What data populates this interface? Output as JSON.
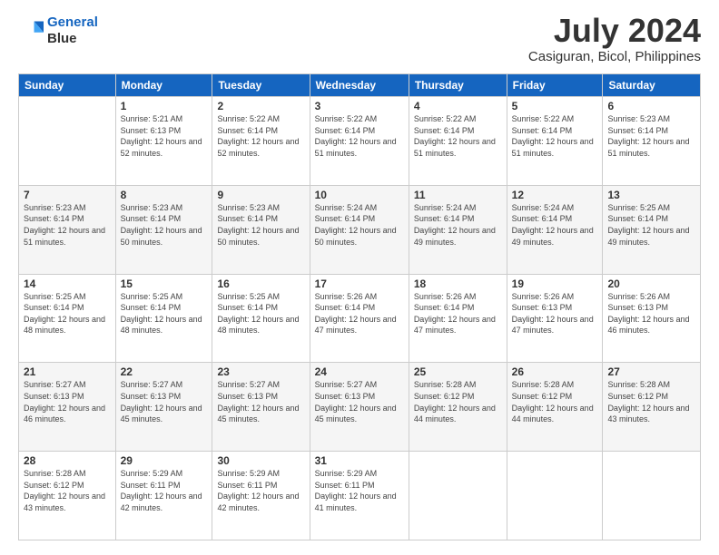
{
  "header": {
    "logo_line1": "General",
    "logo_line2": "Blue",
    "month_title": "July 2024",
    "location": "Casiguran, Bicol, Philippines"
  },
  "weekdays": [
    "Sunday",
    "Monday",
    "Tuesday",
    "Wednesday",
    "Thursday",
    "Friday",
    "Saturday"
  ],
  "weeks": [
    [
      {
        "day": "",
        "sunrise": "",
        "sunset": "",
        "daylight": ""
      },
      {
        "day": "1",
        "sunrise": "Sunrise: 5:21 AM",
        "sunset": "Sunset: 6:13 PM",
        "daylight": "Daylight: 12 hours and 52 minutes."
      },
      {
        "day": "2",
        "sunrise": "Sunrise: 5:22 AM",
        "sunset": "Sunset: 6:14 PM",
        "daylight": "Daylight: 12 hours and 52 minutes."
      },
      {
        "day": "3",
        "sunrise": "Sunrise: 5:22 AM",
        "sunset": "Sunset: 6:14 PM",
        "daylight": "Daylight: 12 hours and 51 minutes."
      },
      {
        "day": "4",
        "sunrise": "Sunrise: 5:22 AM",
        "sunset": "Sunset: 6:14 PM",
        "daylight": "Daylight: 12 hours and 51 minutes."
      },
      {
        "day": "5",
        "sunrise": "Sunrise: 5:22 AM",
        "sunset": "Sunset: 6:14 PM",
        "daylight": "Daylight: 12 hours and 51 minutes."
      },
      {
        "day": "6",
        "sunrise": "Sunrise: 5:23 AM",
        "sunset": "Sunset: 6:14 PM",
        "daylight": "Daylight: 12 hours and 51 minutes."
      }
    ],
    [
      {
        "day": "7",
        "sunrise": "Sunrise: 5:23 AM",
        "sunset": "Sunset: 6:14 PM",
        "daylight": "Daylight: 12 hours and 51 minutes."
      },
      {
        "day": "8",
        "sunrise": "Sunrise: 5:23 AM",
        "sunset": "Sunset: 6:14 PM",
        "daylight": "Daylight: 12 hours and 50 minutes."
      },
      {
        "day": "9",
        "sunrise": "Sunrise: 5:23 AM",
        "sunset": "Sunset: 6:14 PM",
        "daylight": "Daylight: 12 hours and 50 minutes."
      },
      {
        "day": "10",
        "sunrise": "Sunrise: 5:24 AM",
        "sunset": "Sunset: 6:14 PM",
        "daylight": "Daylight: 12 hours and 50 minutes."
      },
      {
        "day": "11",
        "sunrise": "Sunrise: 5:24 AM",
        "sunset": "Sunset: 6:14 PM",
        "daylight": "Daylight: 12 hours and 49 minutes."
      },
      {
        "day": "12",
        "sunrise": "Sunrise: 5:24 AM",
        "sunset": "Sunset: 6:14 PM",
        "daylight": "Daylight: 12 hours and 49 minutes."
      },
      {
        "day": "13",
        "sunrise": "Sunrise: 5:25 AM",
        "sunset": "Sunset: 6:14 PM",
        "daylight": "Daylight: 12 hours and 49 minutes."
      }
    ],
    [
      {
        "day": "14",
        "sunrise": "Sunrise: 5:25 AM",
        "sunset": "Sunset: 6:14 PM",
        "daylight": "Daylight: 12 hours and 48 minutes."
      },
      {
        "day": "15",
        "sunrise": "Sunrise: 5:25 AM",
        "sunset": "Sunset: 6:14 PM",
        "daylight": "Daylight: 12 hours and 48 minutes."
      },
      {
        "day": "16",
        "sunrise": "Sunrise: 5:25 AM",
        "sunset": "Sunset: 6:14 PM",
        "daylight": "Daylight: 12 hours and 48 minutes."
      },
      {
        "day": "17",
        "sunrise": "Sunrise: 5:26 AM",
        "sunset": "Sunset: 6:14 PM",
        "daylight": "Daylight: 12 hours and 47 minutes."
      },
      {
        "day": "18",
        "sunrise": "Sunrise: 5:26 AM",
        "sunset": "Sunset: 6:14 PM",
        "daylight": "Daylight: 12 hours and 47 minutes."
      },
      {
        "day": "19",
        "sunrise": "Sunrise: 5:26 AM",
        "sunset": "Sunset: 6:13 PM",
        "daylight": "Daylight: 12 hours and 47 minutes."
      },
      {
        "day": "20",
        "sunrise": "Sunrise: 5:26 AM",
        "sunset": "Sunset: 6:13 PM",
        "daylight": "Daylight: 12 hours and 46 minutes."
      }
    ],
    [
      {
        "day": "21",
        "sunrise": "Sunrise: 5:27 AM",
        "sunset": "Sunset: 6:13 PM",
        "daylight": "Daylight: 12 hours and 46 minutes."
      },
      {
        "day": "22",
        "sunrise": "Sunrise: 5:27 AM",
        "sunset": "Sunset: 6:13 PM",
        "daylight": "Daylight: 12 hours and 45 minutes."
      },
      {
        "day": "23",
        "sunrise": "Sunrise: 5:27 AM",
        "sunset": "Sunset: 6:13 PM",
        "daylight": "Daylight: 12 hours and 45 minutes."
      },
      {
        "day": "24",
        "sunrise": "Sunrise: 5:27 AM",
        "sunset": "Sunset: 6:13 PM",
        "daylight": "Daylight: 12 hours and 45 minutes."
      },
      {
        "day": "25",
        "sunrise": "Sunrise: 5:28 AM",
        "sunset": "Sunset: 6:12 PM",
        "daylight": "Daylight: 12 hours and 44 minutes."
      },
      {
        "day": "26",
        "sunrise": "Sunrise: 5:28 AM",
        "sunset": "Sunset: 6:12 PM",
        "daylight": "Daylight: 12 hours and 44 minutes."
      },
      {
        "day": "27",
        "sunrise": "Sunrise: 5:28 AM",
        "sunset": "Sunset: 6:12 PM",
        "daylight": "Daylight: 12 hours and 43 minutes."
      }
    ],
    [
      {
        "day": "28",
        "sunrise": "Sunrise: 5:28 AM",
        "sunset": "Sunset: 6:12 PM",
        "daylight": "Daylight: 12 hours and 43 minutes."
      },
      {
        "day": "29",
        "sunrise": "Sunrise: 5:29 AM",
        "sunset": "Sunset: 6:11 PM",
        "daylight": "Daylight: 12 hours and 42 minutes."
      },
      {
        "day": "30",
        "sunrise": "Sunrise: 5:29 AM",
        "sunset": "Sunset: 6:11 PM",
        "daylight": "Daylight: 12 hours and 42 minutes."
      },
      {
        "day": "31",
        "sunrise": "Sunrise: 5:29 AM",
        "sunset": "Sunset: 6:11 PM",
        "daylight": "Daylight: 12 hours and 41 minutes."
      },
      {
        "day": "",
        "sunrise": "",
        "sunset": "",
        "daylight": ""
      },
      {
        "day": "",
        "sunrise": "",
        "sunset": "",
        "daylight": ""
      },
      {
        "day": "",
        "sunrise": "",
        "sunset": "",
        "daylight": ""
      }
    ]
  ]
}
